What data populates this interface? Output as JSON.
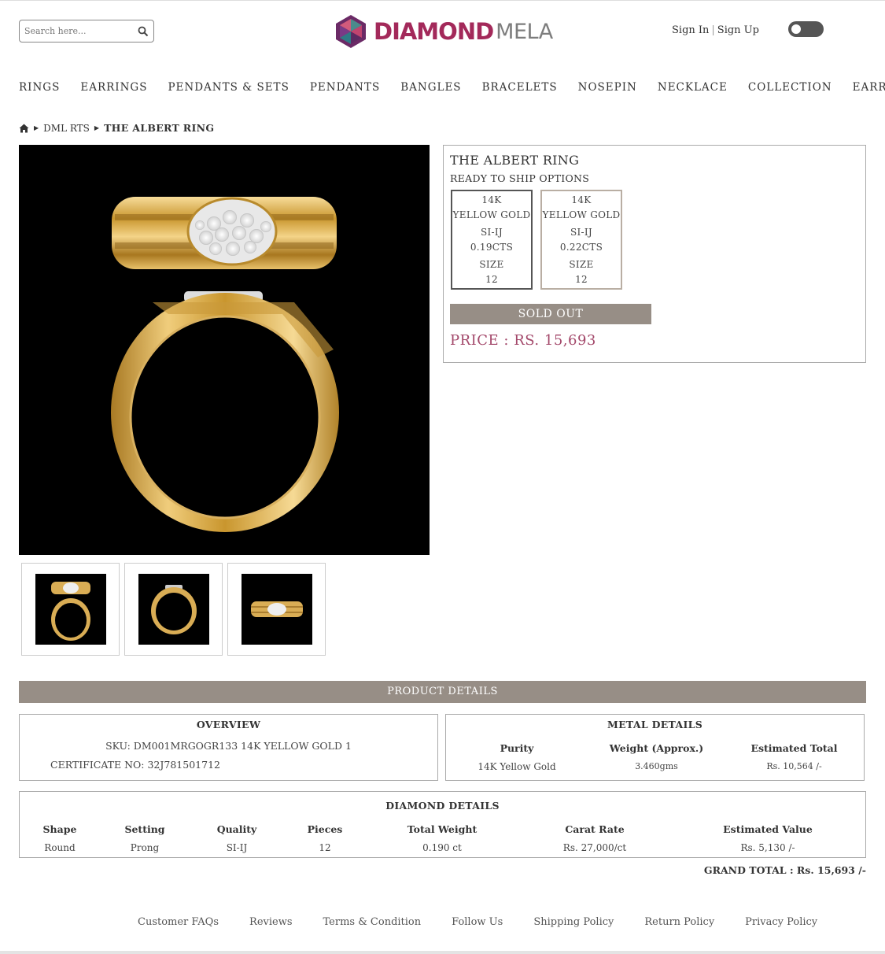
{
  "header": {
    "search_placeholder": "Search here...",
    "logo": {
      "word1": "DIAMOND",
      "word2": "MELA"
    },
    "sign_in": "Sign In",
    "separator": "|",
    "sign_up": "Sign Up"
  },
  "nav": [
    "RINGS",
    "EARRINGS",
    "PENDANTS & SETS",
    "PENDANTS",
    "BANGLES",
    "BRACELETS",
    "NOSEPIN",
    "NECKLACE",
    "COLLECTION",
    "EARRING"
  ],
  "breadcrumb": {
    "level1": "DML RTS",
    "current": "THE ALBERT RING"
  },
  "product": {
    "title": "THE ALBERT RING",
    "subtitle": "READY TO SHIP OPTIONS",
    "options": [
      {
        "karat": "14K",
        "metal": "YELLOW GOLD",
        "quality": "SI-IJ",
        "carats": "0.19CTS",
        "size_label": "SIZE",
        "size": "12"
      },
      {
        "karat": "14K",
        "metal": "YELLOW GOLD",
        "quality": "SI-IJ",
        "carats": "0.22CTS",
        "size_label": "SIZE",
        "size": "12"
      }
    ],
    "sold_out": "SOLD OUT",
    "price": "PRICE : RS. 15,693"
  },
  "details": {
    "bar_title": "PRODUCT DETAILS",
    "overview": {
      "heading": "OVERVIEW",
      "sku": "SKU: DM001MRGOGR133 14K YELLOW GOLD 1",
      "certificate": "CERTIFICATE NO: 32J781501712"
    },
    "metal": {
      "heading": "METAL DETAILS",
      "columns": [
        "Purity",
        "Weight (Approx.)",
        "Estimated Total"
      ],
      "values": [
        "14K Yellow Gold",
        "3.460gms",
        "Rs. 10,564 /-"
      ]
    },
    "diamond": {
      "heading": "DIAMOND DETAILS",
      "columns": [
        "Shape",
        "Setting",
        "Quality",
        "Pieces",
        "Total Weight",
        "Carat Rate",
        "Estimated Value"
      ],
      "values": [
        "Round",
        "Prong",
        "SI-IJ",
        "12",
        "0.190 ct",
        "Rs. 27,000/ct",
        "Rs. 5,130 /-"
      ]
    },
    "grand_total": "GRAND TOTAL : Rs. 15,693 /-"
  },
  "footer": [
    "Customer FAQs",
    "Reviews",
    "Terms & Condition",
    "Follow Us",
    "Shipping Policy",
    "Return Policy",
    "Privacy Policy"
  ],
  "colors": {
    "brand": "#a3295a",
    "bar": "#978e86",
    "price": "#a3486a"
  }
}
